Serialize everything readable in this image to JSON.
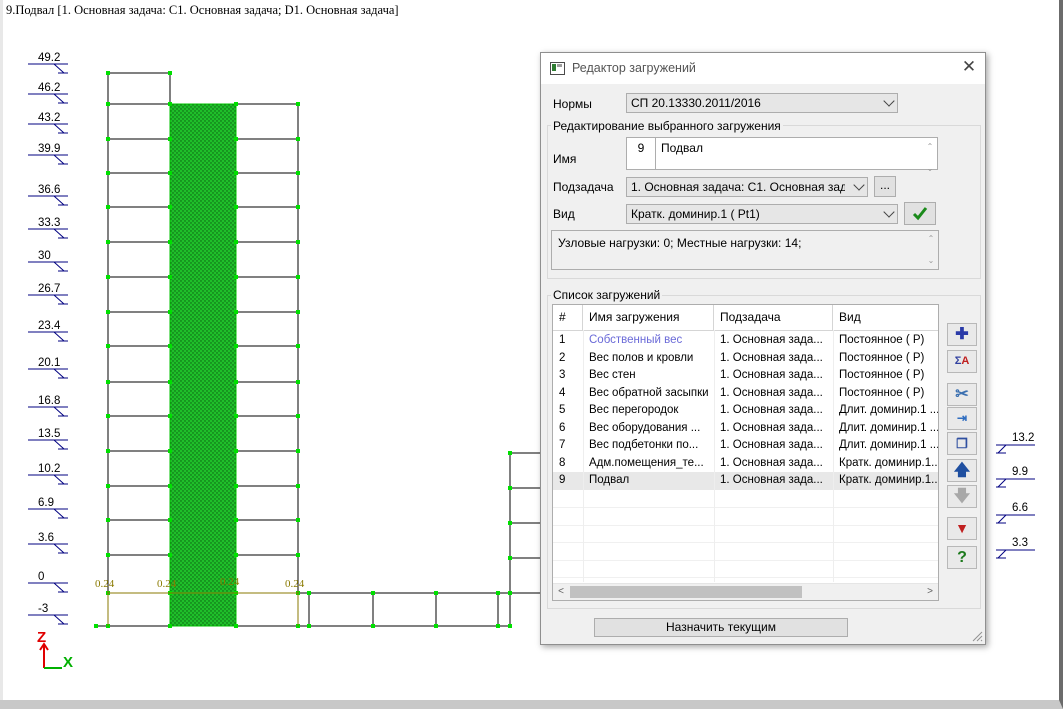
{
  "viewport": {
    "title": "9.Подвал [1. Основная задача: С1. Основная задача; D1. Основная задача]",
    "left_levels": [
      "49.2",
      "46.2",
      "43.2",
      "39.9",
      "36.6",
      "33.3",
      "30",
      "26.7",
      "23.4",
      "20.1",
      "16.8",
      "13.5",
      "10.2",
      "6.9",
      "3.6",
      "0",
      "-3"
    ],
    "right_levels": [
      "13.2",
      "9.9",
      "6.6",
      "3.3"
    ],
    "dims": [
      "0.24",
      "0.24",
      "0.24",
      "0.24"
    ],
    "axis": {
      "z": "Z",
      "x": "X"
    },
    "colors": {
      "load_fill": "#1fbf2a",
      "node": "#00e000",
      "level_line": "#000080",
      "dim": "#8a7a00"
    }
  },
  "dialog": {
    "title": "Редактор загружений",
    "norms_label": "Нормы",
    "norms_value": "СП 20.13330.2011/2016",
    "edit_group": "Редактирование выбранного загружения",
    "name_label": "Имя",
    "number": "9",
    "name_value": "Подвал",
    "subtask_label": "Подзадача",
    "subtask_value": "1. Основная задача: С1. Основная задач",
    "subtask_btn": "...",
    "kind_label": "Вид",
    "kind_value": "Кратк. доминир.1 ( Pt1)",
    "info": "Узловые нагрузки:  0;  Местные нагрузки:  14;",
    "list_group": "Список загружений",
    "columns": [
      "#",
      "Имя загружения",
      "Подзадача",
      "Вид"
    ],
    "rows": [
      {
        "n": "1",
        "name": "Собственный вес",
        "sub": "1. Основная зада...",
        "kind": "Постоянное ( Р)"
      },
      {
        "n": "2",
        "name": "Вес полов и кровли",
        "sub": "1. Основная зада...",
        "kind": "Постоянное ( Р)"
      },
      {
        "n": "3",
        "name": "Вес стен",
        "sub": "1. Основная зада...",
        "kind": "Постоянное ( Р)"
      },
      {
        "n": "4",
        "name": "Вес обратной засыпки",
        "sub": "1. Основная зада...",
        "kind": "Постоянное ( Р)"
      },
      {
        "n": "5",
        "name": "Вес перегородок",
        "sub": "1. Основная зада...",
        "kind": "Длит. доминир.1 ..."
      },
      {
        "n": "6",
        "name": "Вес оборудования ...",
        "sub": "1. Основная зада...",
        "kind": "Длит. доминир.1 ..."
      },
      {
        "n": "7",
        "name": "Вес подбетонки по...",
        "sub": "1. Основная зада...",
        "kind": "Длит. доминир.1 ..."
      },
      {
        "n": "8",
        "name": "Адм.помещения_те...",
        "sub": "1. Основная зада...",
        "kind": "Кратк. доминир.1..."
      },
      {
        "n": "9",
        "name": "Подвал",
        "sub": "1. Основная зада...",
        "kind": "Кратк. доминир.1..."
      }
    ],
    "assign_button": "Назначить текущим",
    "side_icons": [
      "add-icon",
      "sum-icon",
      "cut-icon",
      "insert-icon",
      "copy-icon",
      "move-up-icon",
      "move-down-icon",
      "filter-icon",
      "help-icon"
    ]
  }
}
